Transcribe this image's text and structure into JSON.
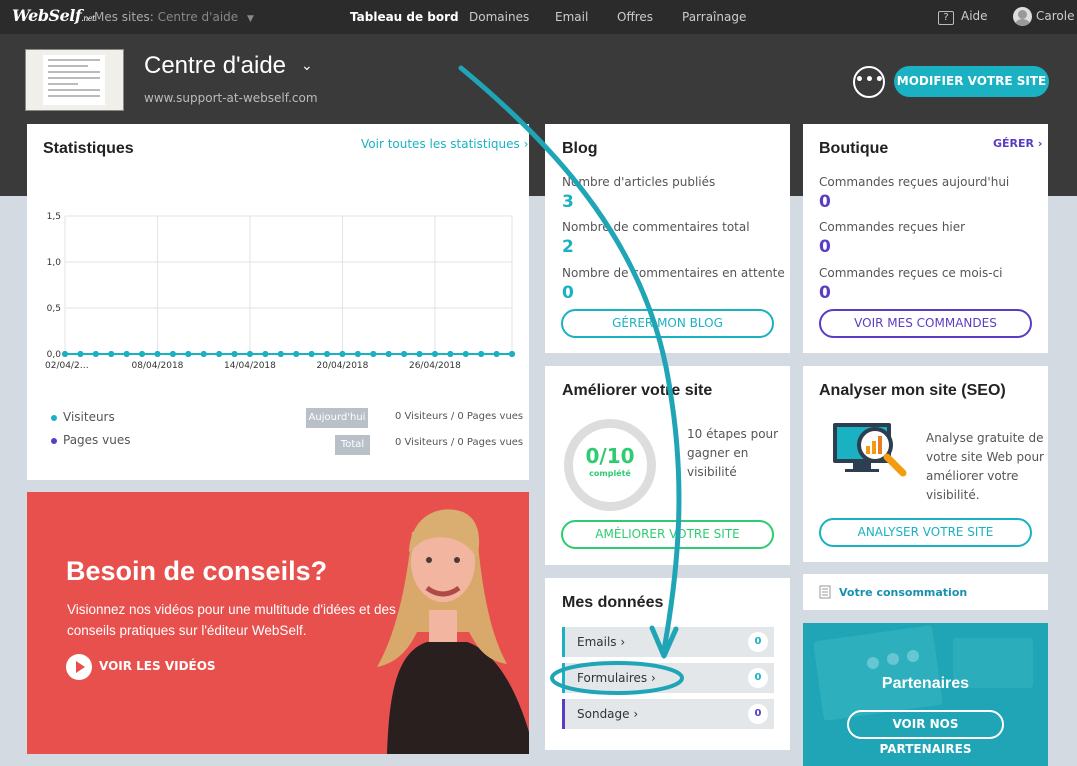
{
  "topbar": {
    "logo": "WebSelf",
    "logo_suffix": ".net",
    "my_sites_label": "Mes sites:",
    "current_site": "Centre d'aide",
    "nav": [
      "Tableau de bord",
      "Domaines",
      "Email",
      "Offres",
      "Parraînage"
    ],
    "help": "Aide",
    "help_glyph": "?",
    "user": "Carole"
  },
  "site_header": {
    "title": "Centre d'aide",
    "url": "www.support-at-webself.com",
    "more_glyph": "•••",
    "modify_button": "MODIFIER VOTRE SITE"
  },
  "stats": {
    "title": "Statistiques",
    "see_all": "Voir toutes les statistiques ›",
    "legend": [
      {
        "label": "Visiteurs",
        "color": "#1ab1c3"
      },
      {
        "label": "Pages vues",
        "color": "#5b3cc4"
      }
    ],
    "today_tag": "Aujourd'hui",
    "total_tag": "Total",
    "today_value": "0 Visiteurs / 0 Pages vues",
    "total_value": "0 Visiteurs / 0 Pages vues"
  },
  "chart_data": {
    "type": "line",
    "x_ticks": [
      "02/04/2…",
      "08/04/2018",
      "14/04/2018",
      "20/04/2018",
      "26/04/2018"
    ],
    "y_ticks": [
      "0,0",
      "0,5",
      "1,0",
      "1,5"
    ],
    "ylim": [
      0,
      1.5
    ],
    "x_count": 30,
    "grid": true,
    "series": [
      {
        "name": "Visiteurs",
        "color": "#1ab1c3",
        "values": [
          0,
          0,
          0,
          0,
          0,
          0,
          0,
          0,
          0,
          0,
          0,
          0,
          0,
          0,
          0,
          0,
          0,
          0,
          0,
          0,
          0,
          0,
          0,
          0,
          0,
          0,
          0,
          0,
          0,
          0
        ]
      },
      {
        "name": "Pages vues",
        "color": "#5b3cc4",
        "values": [
          0,
          0,
          0,
          0,
          0,
          0,
          0,
          0,
          0,
          0,
          0,
          0,
          0,
          0,
          0,
          0,
          0,
          0,
          0,
          0,
          0,
          0,
          0,
          0,
          0,
          0,
          0,
          0,
          0,
          0
        ]
      }
    ]
  },
  "blog": {
    "title": "Blog",
    "articles_label": "Nombre d'articles publiés",
    "articles_value": "3",
    "comments_label": "Nombre de commentaires total",
    "comments_value": "2",
    "pending_label": "Nombre de commentaires en attente",
    "pending_value": "0",
    "button": "GÉRER MON BLOG"
  },
  "shop": {
    "title": "Boutique",
    "manage": "GÉRER ›",
    "today_label": "Commandes reçues aujourd'hui",
    "today_value": "0",
    "yesterday_label": "Commandes reçues hier",
    "yesterday_value": "0",
    "month_label": "Commandes reçues ce mois-ci",
    "month_value": "0",
    "button": "VOIR MES COMMANDES"
  },
  "improve": {
    "title": "Améliorer votre site",
    "progress": "0/10",
    "progress_fraction": 0,
    "done_label": "complété",
    "text": "10 étapes pour gagner en visibilité",
    "button": "AMÉLIORER VOTRE SITE"
  },
  "seo": {
    "title": "Analyser mon site (SEO)",
    "text": "Analyse gratuite de votre site Web pour améliorer votre visibilité.",
    "button": "ANALYSER VOTRE SITE"
  },
  "banner": {
    "title": "Besoin de conseils?",
    "text": "Visionnez nos vidéos pour une multitude d'idées et des conseils pratiques sur l'éditeur WebSelf.",
    "video_link": "VOIR LES VIDÉOS"
  },
  "data": {
    "title": "Mes données",
    "rows": [
      {
        "label": "Emails ›",
        "count": "0",
        "color": "#1ab1c3"
      },
      {
        "label": "Formulaires ›",
        "count": "0",
        "color": "#1ab1c3"
      },
      {
        "label": "Sondage ›",
        "count": "0",
        "color": "#5b3cc4"
      }
    ]
  },
  "consumption": {
    "label": "Votre consommation"
  },
  "partners": {
    "title": "Partenaires",
    "button": "VOIR NOS PARTENAIRES"
  },
  "colors": {
    "accent": "#1ab1c3",
    "purple": "#5b3cc4",
    "green": "#2ecc71",
    "red": "#e8504e"
  }
}
